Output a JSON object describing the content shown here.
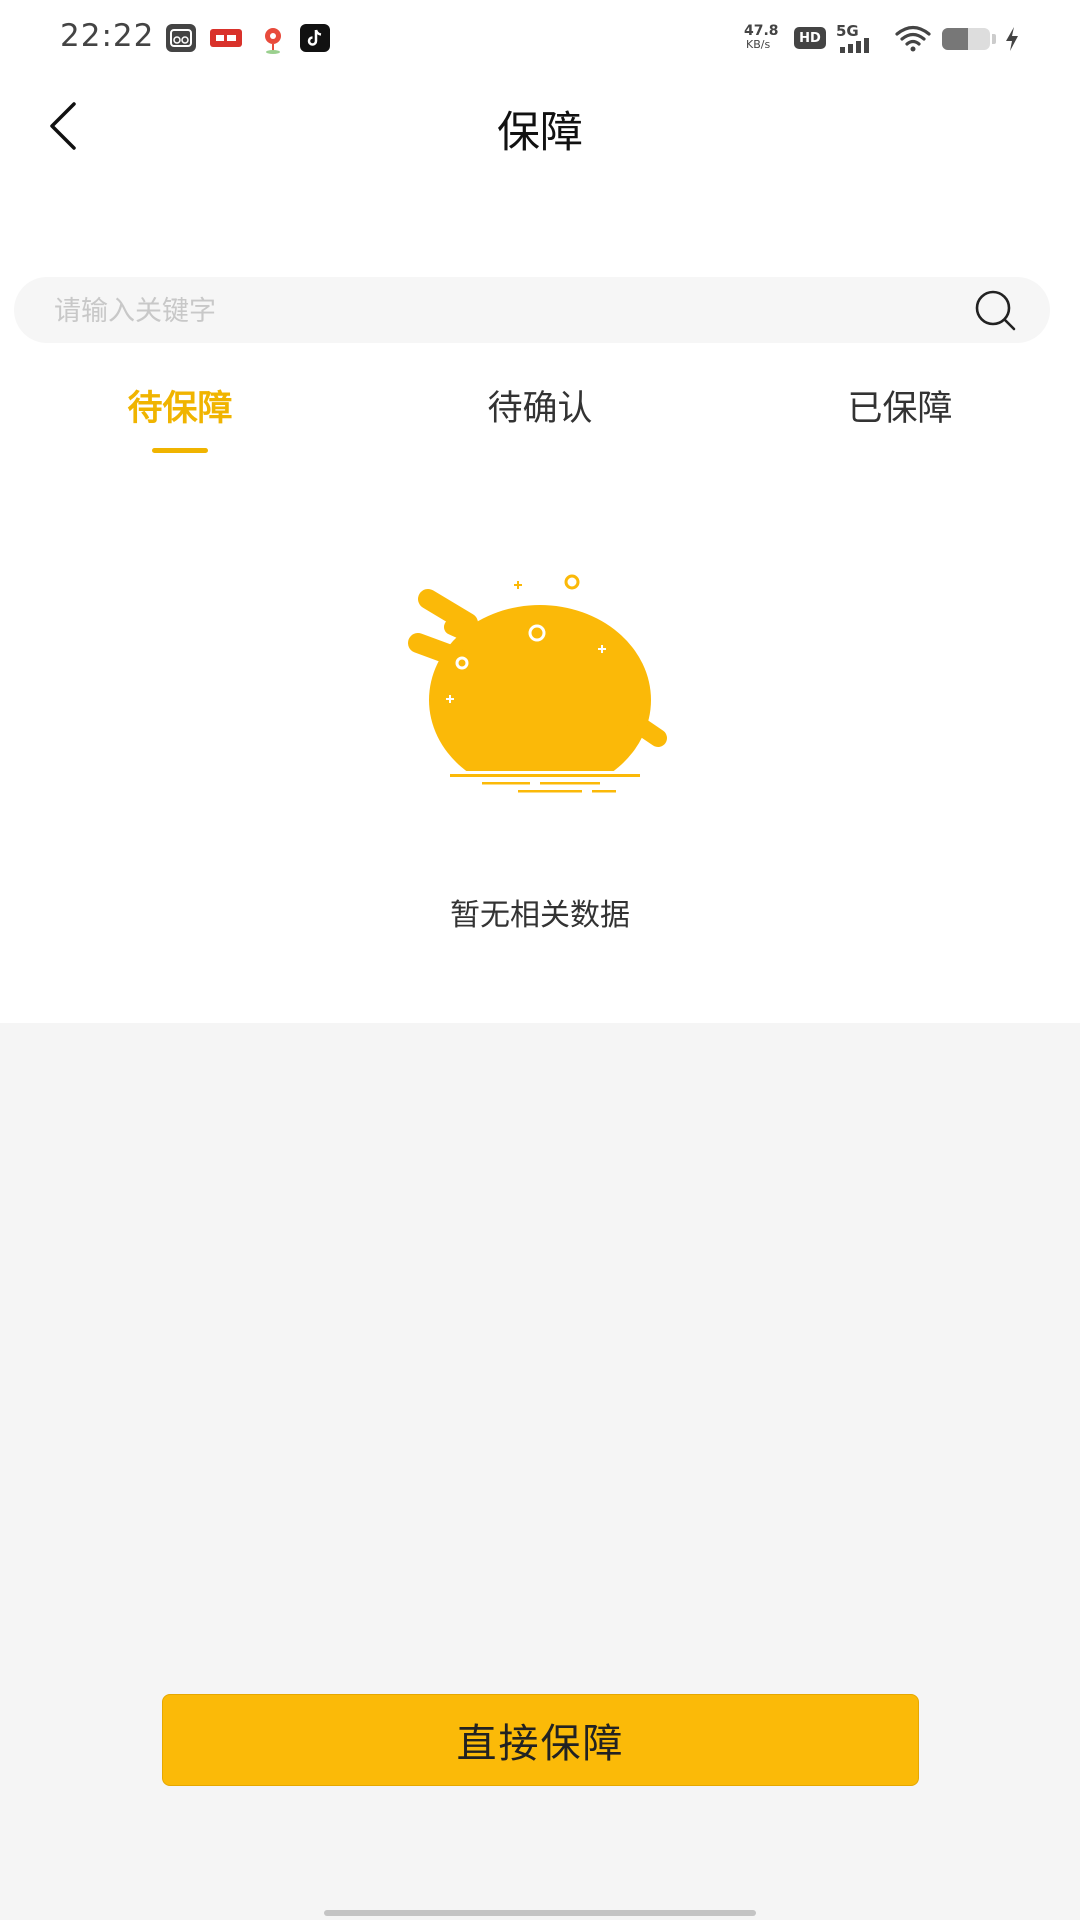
{
  "status_bar": {
    "time": "22:22",
    "net_speed_value": "47.8",
    "net_speed_unit": "KB/s",
    "hd_label": "HD",
    "network_label": "5G",
    "battery_level": 0.55,
    "icons": [
      "gallery-app-icon",
      "toutiao-app-icon",
      "location-app-icon",
      "tiktok-app-icon",
      "wifi-icon",
      "battery-icon",
      "charging-icon"
    ]
  },
  "header": {
    "title": "保障",
    "back_icon": "chevron-left-icon"
  },
  "search": {
    "placeholder": "请输入关键字",
    "value": "",
    "icon": "search-icon"
  },
  "tabs": [
    {
      "label": "待保障",
      "active": true
    },
    {
      "label": "待确认",
      "active": false
    },
    {
      "label": "已保障",
      "active": false
    }
  ],
  "empty_state": {
    "illustration": "empty-sun-illustration",
    "message": "暂无相关数据"
  },
  "action": {
    "button_label": "直接保障"
  },
  "colors": {
    "accent": "#f0b400",
    "button": "#fbba08",
    "page_background": "#f5f5f5"
  }
}
